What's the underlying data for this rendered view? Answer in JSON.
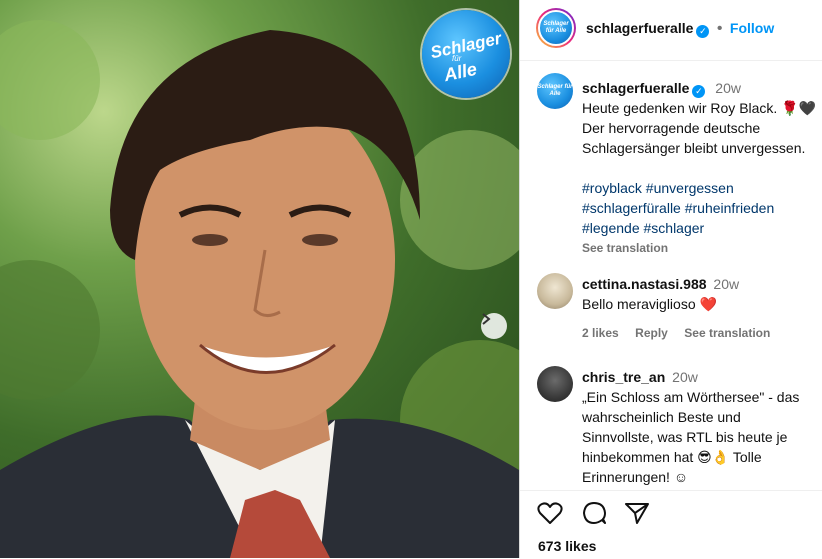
{
  "post": {
    "badge": {
      "line1": "Schlager",
      "line2": "für",
      "line3": "Alle"
    },
    "avatar_text": "Schlager für Alle",
    "username": "schlagerfueralle",
    "follow_label": "Follow",
    "bullet": "•",
    "verified_glyph": "✓",
    "caption": {
      "time": "20w",
      "line1": "Heute gedenken wir Roy Black. 🌹🖤",
      "line2": "Der hervorragende deutsche",
      "line3": "Schlagersänger bleibt unvergessen.",
      "tags1": "#royblack #unvergessen",
      "tags2": "#schlagerfüralle #ruheinfrieden",
      "tags3": "#legende #schlager",
      "see_translation": "See translation"
    }
  },
  "comments": [
    {
      "username": "cettina.nastasi.988",
      "time": "20w",
      "text": "Bello meraviglioso ❤️",
      "likes": "2 likes",
      "reply": "Reply",
      "see_translation": "See translation"
    },
    {
      "username": "chris_tre_an",
      "time": "20w",
      "line1": "„Ein Schloss am Wörthersee\" - das",
      "line2": "wahrscheinlich Beste und",
      "line3": "Sinnvollste, was RTL bis heute je",
      "line4": "hinbekommen hat 😎👌 Tolle",
      "line5": "Erinnerungen! ☺"
    }
  ],
  "footer": {
    "likes": "673 likes"
  },
  "icons": [
    "heart-icon",
    "comment-icon",
    "share-icon",
    "next-arrow-icon",
    "verified-icon"
  ],
  "colors": {
    "link": "#0095f6",
    "hashtag": "#00376b",
    "muted": "#737373",
    "like_red": "#ed4956"
  }
}
